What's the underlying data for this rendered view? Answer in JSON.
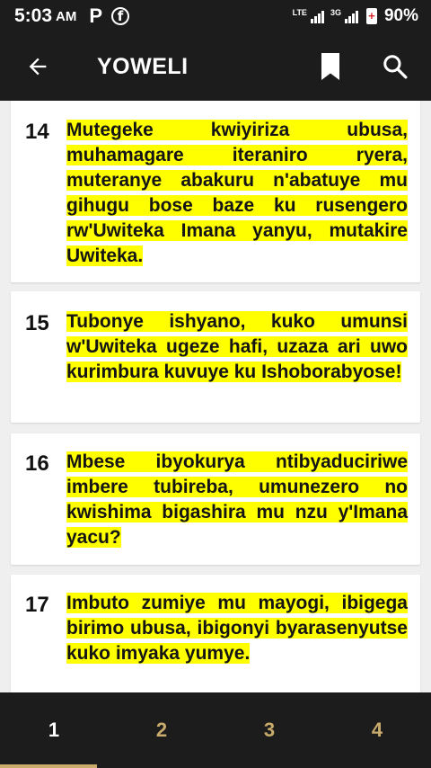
{
  "status": {
    "time": "5:03",
    "ampm": "AM",
    "app_badge": "P",
    "fb_badge": "f",
    "lte_label": "LTE",
    "net_label": "3G",
    "battery": "90%"
  },
  "toolbar": {
    "title": "YOWELI"
  },
  "verses": [
    {
      "num": "14",
      "text": "Mutegeke kwiyiriza ubusa, muhamagare iteraniro ryera, muteranye abakuru n'abatuye mu gihugu bose baze ku rusengero rw'Uwiteka Imana yanyu, mutakire Uwiteka."
    },
    {
      "num": "15",
      "text": "Tubonye ishyano, kuko umunsi w'Uwiteka ugeze hafi, uzaza ari uwo kurimbura kuvuye ku Ishoborabyose!"
    },
    {
      "num": "16",
      "text": "Mbese ibyokurya ntibyaduciriwe imbere tubireba, umunezero no kwishima bigashira mu nzu y'Imana yacu?"
    },
    {
      "num": "17",
      "text": "Imbuto zumiye mu mayogi, ibigega birimo ubusa, ibigonyi byarasenyutse kuko imyaka yumye."
    }
  ],
  "tabs": [
    {
      "label": "1",
      "active": true
    },
    {
      "label": "2",
      "active": false
    },
    {
      "label": "3",
      "active": false
    },
    {
      "label": "4",
      "active": false
    }
  ],
  "colors": {
    "bar": "#1c1c1c",
    "highlight": "#ffff00",
    "tab_inactive": "#c9ac6c"
  }
}
